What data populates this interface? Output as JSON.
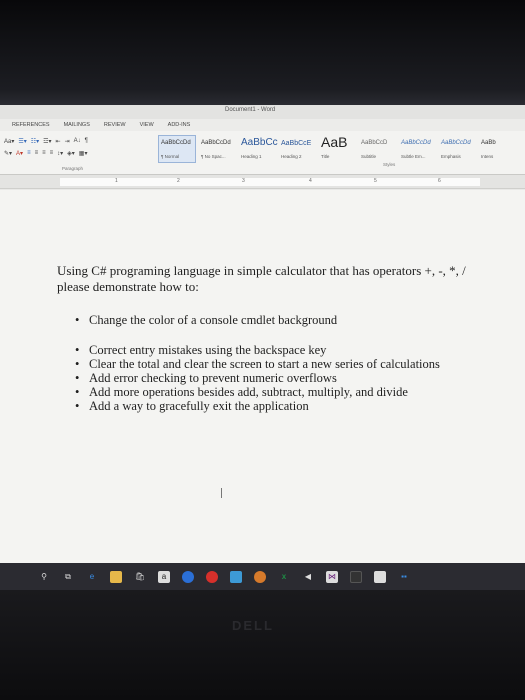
{
  "app": {
    "window_title": "Document1 - Word",
    "brand": "DELL"
  },
  "ribbon": {
    "tabs": [
      "REFERENCES",
      "MAILINGS",
      "REVIEW",
      "VIEW",
      "ADD-INS"
    ],
    "group_paragraph": "Paragraph",
    "group_styles": "Styles",
    "styles": [
      {
        "sample": "AaBbCcDd",
        "name": "¶ Normal",
        "selected": true
      },
      {
        "sample": "AaBbCcDd",
        "name": "¶ No Spac..."
      },
      {
        "sample": "AaBbCc",
        "name": "Heading 1"
      },
      {
        "sample": "AaBbCcE",
        "name": "Heading 2"
      },
      {
        "sample": "AaB",
        "name": "Title"
      },
      {
        "sample": "AaBbCcD",
        "name": "Subtitle"
      },
      {
        "sample": "AaBbCcDd",
        "name": "Subtle Em..."
      },
      {
        "sample": "AaBbCcDd",
        "name": "Emphasis"
      },
      {
        "sample": "AaBb",
        "name": "Intens"
      }
    ]
  },
  "ruler": {
    "ticks": [
      "1",
      "2",
      "3",
      "4",
      "5",
      "6"
    ]
  },
  "document": {
    "question": "Using C# programing language in simple calculator that has operators +, -, *, / please demonstrate how to:",
    "bullets": [
      "Change the color of a console cmdlet background",
      "Correct entry mistakes using the backspace key",
      "Clear the total and clear the screen to start a new series of calculations",
      "Add error checking to prevent numeric overflows",
      "Add more operations besides add, subtract, multiply, and divide",
      "Add a way to gracefully exit the application"
    ]
  },
  "colors": {
    "ribbon_bg": "#f3f3f1",
    "document_bg": "#f4f4f2",
    "taskbar_bg": "#2b2b31",
    "heading_blue": "#2b579a"
  },
  "taskbar_icons": [
    "search-icon",
    "task-view-icon",
    "edge-browser-icon",
    "file-explorer-icon",
    "store-icon",
    "amazon-icon",
    "chrome-icon",
    "opera-icon",
    "photos-icon",
    "media-icon",
    "excel-icon",
    "skype-icon",
    "visual-studio-icon",
    "word-icon",
    "app-icon",
    "settings-icon"
  ]
}
